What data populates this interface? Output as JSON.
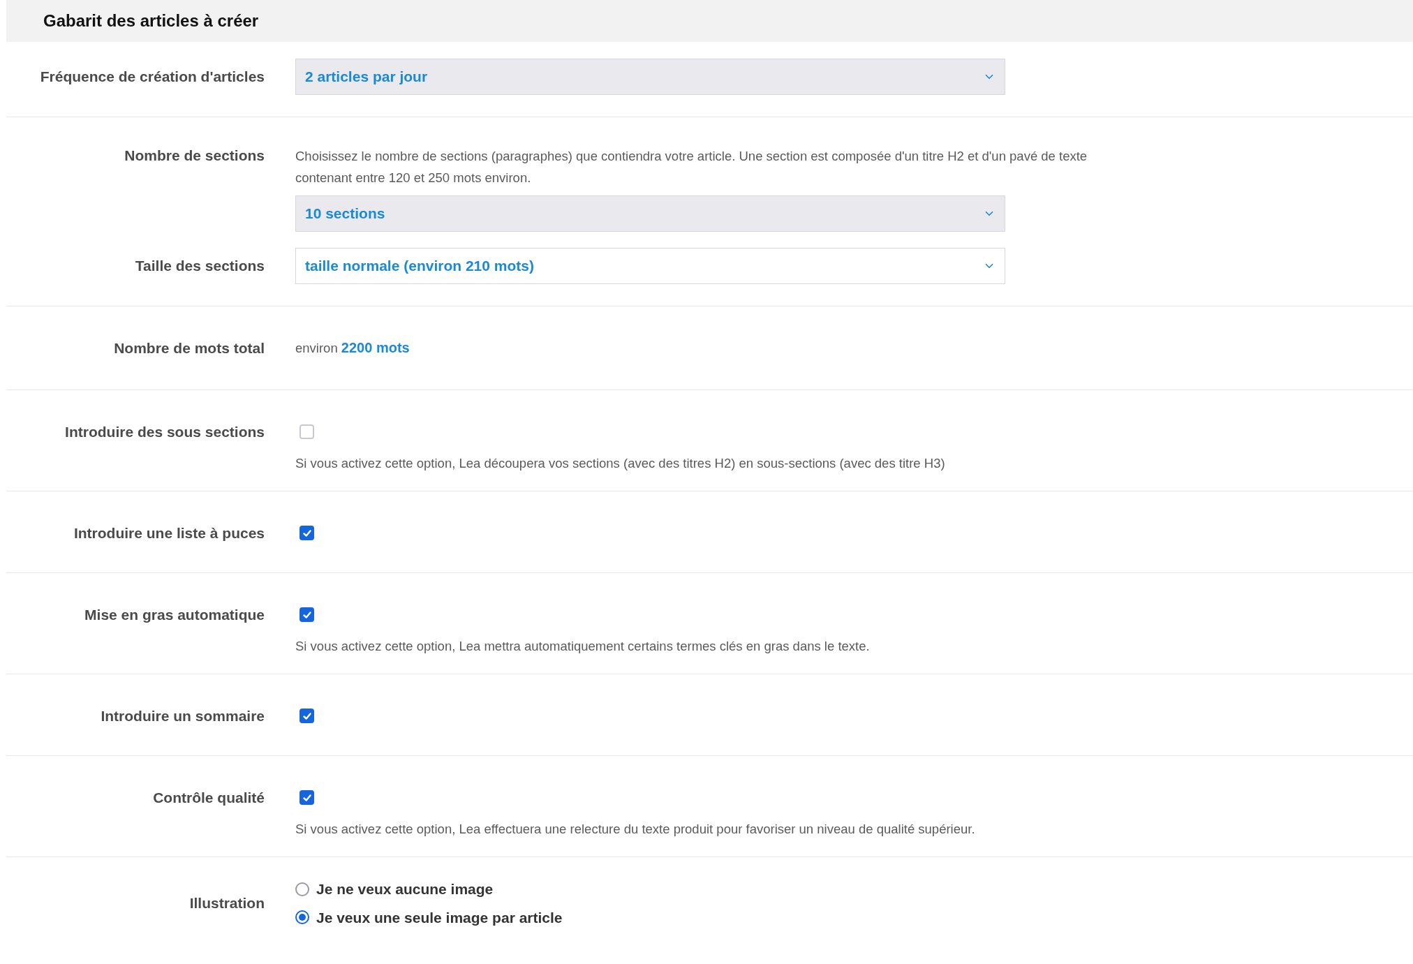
{
  "header": {
    "title": "Gabarit des articles à créer"
  },
  "groups": [
    {
      "fields": [
        {
          "kind": "select",
          "label": "Fréquence de création d'articles",
          "value": "2 articles par jour",
          "shaded": true
        }
      ]
    },
    {
      "fields": [
        {
          "kind": "select",
          "label": "Nombre de sections",
          "description": "Choisissez le nombre de sections (paragraphes) que contiendra votre article. Une section est composée d'un titre H2 et d'un pavé de texte contenant entre 120 et 250 mots environ.",
          "value": "10 sections",
          "shaded": true
        },
        {
          "kind": "select",
          "label": "Taille des sections",
          "value": "taille normale (environ 210 mots)",
          "shaded": false
        }
      ]
    },
    {
      "fields": [
        {
          "kind": "total",
          "label": "Nombre de mots total",
          "prefix": "environ",
          "value": "2200 mots"
        }
      ]
    },
    {
      "fields": [
        {
          "kind": "checkbox",
          "label": "Introduire des sous sections",
          "checked": false,
          "description": "Si vous activez cette option, Lea découpera vos sections (avec des titres H2) en sous-sections (avec des titre H3)"
        }
      ]
    },
    {
      "fields": [
        {
          "kind": "checkbox",
          "label": "Introduire une liste à puces",
          "checked": true
        }
      ]
    },
    {
      "fields": [
        {
          "kind": "checkbox",
          "label": "Mise en gras automatique",
          "checked": true,
          "description": "Si vous activez cette option, Lea mettra automatiquement certains termes clés en gras dans le texte."
        }
      ]
    },
    {
      "fields": [
        {
          "kind": "checkbox",
          "label": "Introduire un sommaire",
          "checked": true
        }
      ]
    },
    {
      "fields": [
        {
          "kind": "checkbox",
          "label": "Contrôle qualité",
          "checked": true,
          "description": "Si vous activez cette option, Lea effectuera une relecture du texte produit pour favoriser un niveau de qualité supérieur."
        }
      ]
    },
    {
      "fields": [
        {
          "kind": "radio",
          "label": "Illustration",
          "options": [
            {
              "label": "Je ne veux aucune image",
              "selected": false
            },
            {
              "label": "Je veux une seule image par article",
              "selected": true
            }
          ]
        }
      ]
    }
  ]
}
